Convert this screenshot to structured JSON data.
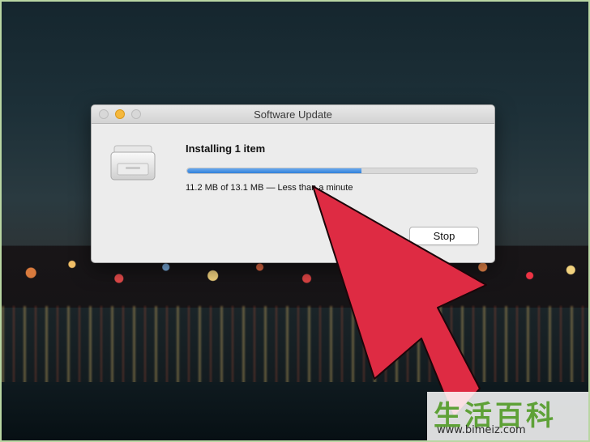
{
  "window": {
    "title": "Software Update",
    "status_title": "Installing 1 item",
    "progress_fraction": 0.6,
    "progress_text": "11.2 MB of 13.1 MB — Less than a minute",
    "stop_label": "Stop"
  },
  "watermark": {
    "chinese_text": "生活百科",
    "url": "www.bimeiz.com"
  },
  "colors": {
    "arrow": "#de2b43",
    "progress": "#2f7fd9",
    "minimize_button": "#f5b83c"
  },
  "icons": {
    "app_icon": "printer-icon"
  }
}
